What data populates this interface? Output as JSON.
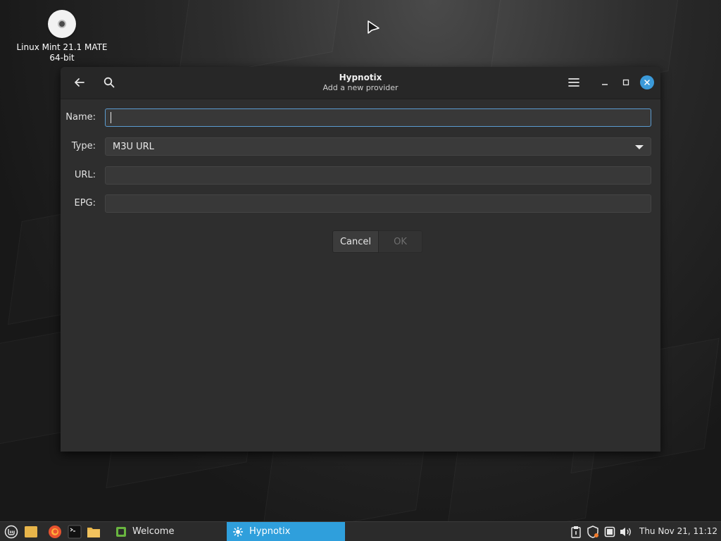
{
  "desktop": {
    "icon_label_line1": "Linux Mint 21.1 MATE",
    "icon_label_line2": "64-bit"
  },
  "window": {
    "title": "Hypnotix",
    "subtitle": "Add a new provider",
    "accent_color": "#3b9ad9"
  },
  "form": {
    "name_label": "Name:",
    "name_value": "",
    "type_label": "Type:",
    "type_value": "M3U URL",
    "url_label": "URL:",
    "url_value": "",
    "epg_label": "EPG:",
    "epg_value": "",
    "cancel_label": "Cancel",
    "ok_label": "OK"
  },
  "taskbar": {
    "tasks": [
      {
        "label": "Welcome",
        "active": false
      },
      {
        "label": "Hypnotix",
        "active": true
      }
    ],
    "clock": "Thu Nov 21, 11:12",
    "active_color": "#2f9fdc"
  }
}
